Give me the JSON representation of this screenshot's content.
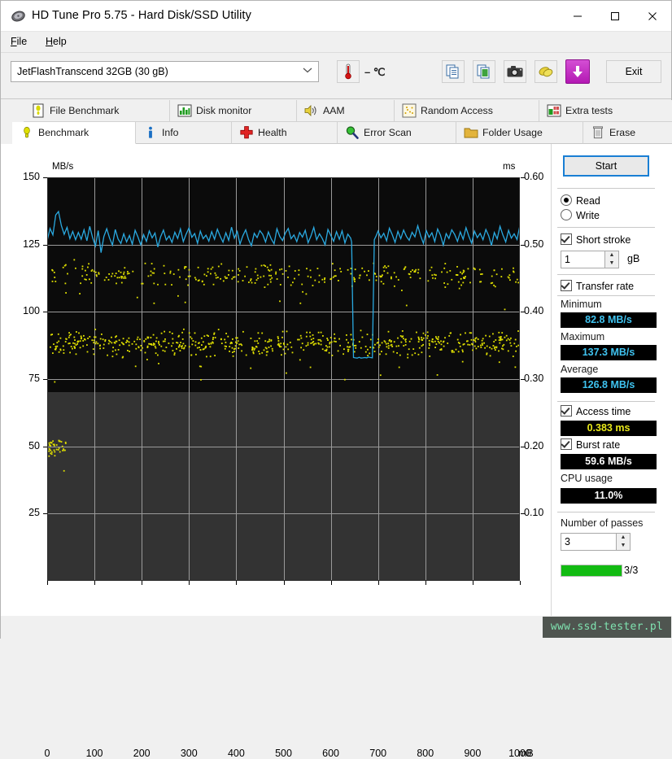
{
  "window": {
    "title": "HD Tune Pro 5.75 - Hard Disk/SSD Utility",
    "icon": "hard-disk-icon",
    "minimize": "—",
    "maximize": "□",
    "close": "✕"
  },
  "menu": {
    "file": "File",
    "help": "Help"
  },
  "toolbar": {
    "drive": "JetFlashTranscend 32GB (30 gB)",
    "drive_chevron": "⌄",
    "temperature": "– ℃",
    "buttons": [
      {
        "name": "temp-button",
        "icon": "thermometer-icon"
      },
      {
        "name": "copy-button",
        "icon": "copy-text-icon"
      },
      {
        "name": "copy-image-button",
        "icon": "copy-image-icon"
      },
      {
        "name": "screenshot-button",
        "icon": "camera-icon"
      },
      {
        "name": "settings-button",
        "icon": "sponge-icon"
      },
      {
        "name": "save-button",
        "icon": "download-arrow-icon"
      }
    ],
    "exit": "Exit"
  },
  "tabs": {
    "top_row": [
      {
        "label": "File Benchmark",
        "icon": "file-benchmark-icon",
        "active": false
      },
      {
        "label": "Disk monitor",
        "icon": "bar-chart-icon",
        "active": false
      },
      {
        "label": "AAM",
        "icon": "speaker-icon",
        "active": false
      },
      {
        "label": "Random Access",
        "icon": "scatter-icon",
        "active": false
      },
      {
        "label": "Extra tests",
        "icon": "extra-tests-icon",
        "active": false
      }
    ],
    "bottom_row": [
      {
        "label": "Benchmark",
        "icon": "bulb-icon",
        "active": true
      },
      {
        "label": "Info",
        "icon": "info-icon",
        "active": false
      },
      {
        "label": "Health",
        "icon": "red-cross-icon",
        "active": false
      },
      {
        "label": "Error Scan",
        "icon": "magnifier-icon",
        "active": false
      },
      {
        "label": "Folder Usage",
        "icon": "folder-icon",
        "active": false
      },
      {
        "label": "Erase",
        "icon": "trash-icon",
        "active": false
      }
    ]
  },
  "panel": {
    "start_label": "Start",
    "mode": {
      "read": "Read",
      "write": "Write",
      "selected": "Read"
    },
    "short_stroke": {
      "label": "Short stroke",
      "checked": true,
      "value": "1",
      "unit": "gB"
    },
    "transfer_rate": {
      "label": "Transfer rate",
      "checked": true
    },
    "minimum": {
      "label": "Minimum",
      "value": "82.8 MB/s"
    },
    "maximum": {
      "label": "Maximum",
      "value": "137.3 MB/s"
    },
    "average": {
      "label": "Average",
      "value": "126.8 MB/s"
    },
    "access_time": {
      "label": "Access time",
      "checked": true,
      "value": "0.383 ms"
    },
    "burst_rate": {
      "label": "Burst rate",
      "checked": true,
      "value": "59.6 MB/s"
    },
    "cpu_usage": {
      "label": "CPU usage",
      "value": "11.0%"
    },
    "passes": {
      "label": "Number of passes",
      "value": "3",
      "progress_text": "3/3",
      "progress_pct": 100
    }
  },
  "watermark": "www.ssd-tester.pl",
  "colors": {
    "transfer_line": "#2aa9e0",
    "access_dots": "#e0e000",
    "plot_bg_upper": "#0b0b0b",
    "plot_bg_lower": "#333333",
    "gridline": "#9a9a9a",
    "accent_blue": "#1a7fd4",
    "progress_green": "#12bb12",
    "value_cyan": "#3fc3f0",
    "value_yellow": "#e8e81a"
  },
  "chart_data": {
    "type": "line",
    "title": "",
    "xlabel": "mB",
    "ylabel": "MB/s",
    "y2label": "ms",
    "xlim": [
      0,
      1000
    ],
    "ylim": [
      0,
      150
    ],
    "y2lim": [
      0,
      0.6
    ],
    "grid": true,
    "legend": null,
    "x_ticks": [
      0,
      100,
      200,
      300,
      400,
      500,
      600,
      700,
      800,
      900,
      1000
    ],
    "y_ticks": [
      25,
      50,
      75,
      100,
      125,
      150
    ],
    "y2_ticks": [
      0.1,
      0.2,
      0.3,
      0.4,
      0.5,
      0.6
    ],
    "series": [
      {
        "name": "Transfer rate",
        "axis": "left",
        "units": "MB/s",
        "color": "#2aa9e0",
        "summary": {
          "minimum": 82.8,
          "maximum": 137.3,
          "average": 126.8
        },
        "x": [
          0,
          6,
          12,
          18,
          24,
          30,
          36,
          42,
          48,
          54,
          60,
          66,
          72,
          78,
          84,
          90,
          96,
          102,
          108,
          114,
          120,
          126,
          132,
          138,
          144,
          150,
          156,
          162,
          168,
          174,
          180,
          186,
          192,
          198,
          204,
          210,
          216,
          222,
          228,
          234,
          240,
          246,
          252,
          258,
          264,
          270,
          276,
          282,
          288,
          294,
          300,
          306,
          312,
          318,
          324,
          330,
          336,
          342,
          348,
          354,
          360,
          366,
          372,
          378,
          384,
          390,
          396,
          402,
          408,
          414,
          420,
          426,
          432,
          438,
          444,
          450,
          456,
          462,
          468,
          474,
          480,
          486,
          492,
          498,
          504,
          510,
          516,
          522,
          528,
          534,
          540,
          546,
          552,
          558,
          564,
          570,
          576,
          582,
          588,
          594,
          600,
          606,
          612,
          618,
          624,
          630,
          636,
          642,
          644,
          648,
          652,
          656,
          660,
          664,
          668,
          672,
          676,
          680,
          684,
          688,
          692,
          696,
          700,
          706,
          712,
          718,
          724,
          730,
          736,
          742,
          748,
          754,
          760,
          766,
          772,
          778,
          784,
          790,
          796,
          802,
          808,
          814,
          820,
          826,
          832,
          838,
          844,
          850,
          856,
          862,
          868,
          874,
          880,
          886,
          892,
          898,
          904,
          910,
          916,
          922,
          928,
          934,
          940,
          946,
          952,
          958,
          964,
          970,
          976,
          982,
          988,
          994,
          1000
        ],
        "y": [
          126.5,
          131.0,
          128.6,
          136.0,
          137.3,
          132.1,
          128.8,
          131.4,
          127.2,
          129.9,
          126.8,
          129.5,
          127.0,
          130.5,
          126.4,
          131.8,
          127.6,
          124.5,
          130.2,
          122.0,
          128.0,
          130.9,
          127.4,
          124.8,
          130.6,
          127.1,
          125.4,
          129.0,
          126.0,
          128.4,
          125.1,
          130.3,
          127.8,
          124.9,
          128.7,
          126.2,
          130.1,
          127.5,
          129.3,
          124.1,
          127.9,
          130.4,
          126.7,
          128.2,
          125.8,
          129.6,
          127.3,
          130.8,
          126.1,
          128.9,
          131.2,
          127.7,
          129.1,
          125.5,
          130.0,
          127.2,
          128.5,
          126.3,
          129.8,
          127.0,
          130.7,
          128.1,
          125.9,
          129.4,
          126.6,
          131.5,
          127.4,
          129.9,
          125.2,
          128.3,
          130.5,
          126.9,
          124.6,
          129.2,
          127.6,
          130.2,
          128.8,
          126.0,
          129.7,
          127.1,
          125.3,
          130.9,
          128.0,
          126.5,
          129.3,
          131.0,
          127.2,
          128.6,
          126.1,
          129.5,
          127.8,
          130.3,
          125.7,
          128.2,
          131.4,
          126.8,
          129.0,
          127.3,
          124.9,
          130.6,
          128.4,
          126.2,
          129.8,
          127.0,
          130.1,
          125.6,
          128.9,
          127.4,
          126.0,
          83.0,
          82.9,
          82.8,
          83.1,
          82.8,
          82.9,
          83.0,
          82.9,
          83.2,
          83.0,
          82.9,
          126.8,
          128.3,
          130.0,
          127.5,
          129.2,
          126.4,
          131.1,
          128.7,
          125.8,
          129.9,
          127.2,
          130.4,
          128.0,
          126.6,
          129.6,
          127.9,
          132.0,
          128.3,
          125.4,
          130.2,
          127.7,
          129.4,
          126.1,
          130.8,
          128.5,
          124.8,
          129.1,
          127.3,
          130.5,
          128.8,
          126.2,
          129.7,
          127.0,
          131.3,
          128.1,
          125.5,
          130.0,
          127.6,
          129.2,
          126.8,
          130.6,
          128.3,
          124.7,
          129.5,
          127.1,
          131.8,
          128.6,
          126.0,
          130.3,
          127.4,
          129.0,
          126.9,
          132.1,
          129.3,
          127.0,
          128.4,
          126.3
        ]
      },
      {
        "name": "Access time",
        "axis": "right",
        "units": "ms",
        "color": "#e0e000",
        "summary": {
          "average": 0.383
        },
        "note": "Scatter cloud: dense band near 0.34-0.37 ms (plotted ~85-92 MB/s equivalent height) and a second band near 0.44-0.47 ms (~110-118), plus a low cluster near 0.18-0.21 ms at the start of the drive."
      }
    ]
  }
}
